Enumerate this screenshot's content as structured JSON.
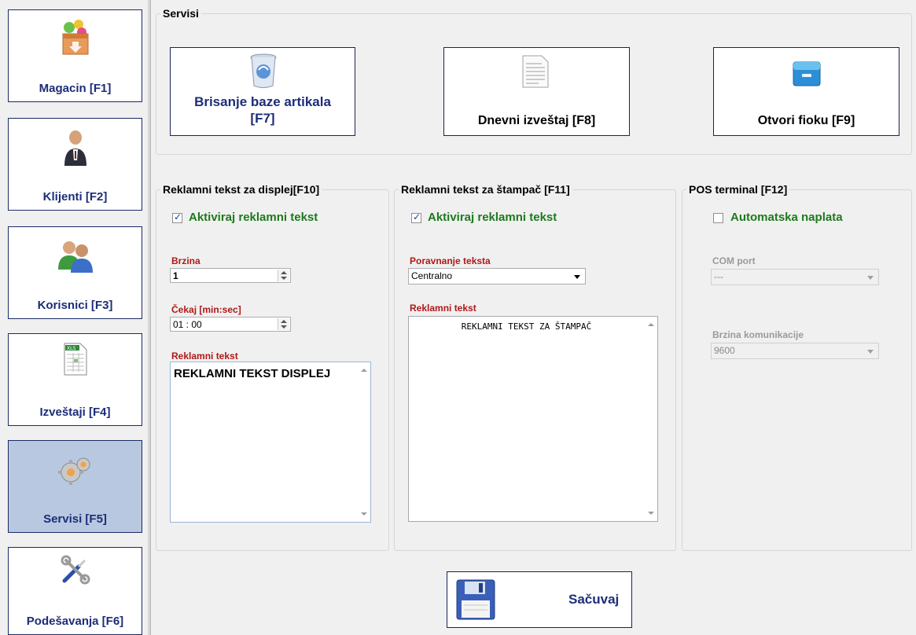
{
  "sidebar": {
    "items": [
      {
        "label": "Magacin [F1]",
        "icon": "warehouse-box-icon"
      },
      {
        "label": "Klijenti [F2]",
        "icon": "client-person-icon"
      },
      {
        "label": "Korisnici [F3]",
        "icon": "users-icon"
      },
      {
        "label": "Izveštaji [F4]",
        "icon": "xls-report-icon"
      },
      {
        "label": "Servisi [F5]",
        "icon": "gears-icon"
      },
      {
        "label": "Podešavanja [F6]",
        "icon": "tools-icon"
      }
    ],
    "active_index": 4
  },
  "servisi": {
    "title": "Servisi",
    "buttons": [
      {
        "label_line1": "Brisanje baze artikala",
        "label_line2": "[F7]",
        "icon": "recycle-bin-icon"
      },
      {
        "label": "Dnevni izveštaj [F8]",
        "icon": "document-icon"
      },
      {
        "label": "Otvori fioku [F9]",
        "icon": "drawer-icon"
      }
    ]
  },
  "display_panel": {
    "title": "Reklamni tekst za displej[F10]",
    "checkbox_label": "Aktiviraj reklamni tekst",
    "checked": true,
    "brzina_label": "Brzina",
    "brzina_value": "1",
    "cekaj_label": "Čekaj [min:sec]",
    "cekaj_value": "01 : 00",
    "text_label": "Reklamni tekst",
    "text_value": "REKLAMNI TEKST DISPLEJ"
  },
  "printer_panel": {
    "title": "Reklamni tekst za štampač [F11]",
    "checkbox_label": "Aktiviraj reklamni tekst",
    "checked": true,
    "align_label": "Poravnanje teksta",
    "align_value": "Centralno",
    "text_label": "Reklamni tekst",
    "text_value": "REKLAMNI TEKST ZA ŠTAMPAČ"
  },
  "pos_panel": {
    "title": "POS terminal [F12]",
    "checkbox_label": "Automatska naplata",
    "checked": false,
    "com_label": "COM port",
    "com_value": "---",
    "speed_label": "Brzina komunikacije",
    "speed_value": "9600"
  },
  "save_button": {
    "label": "Sačuvaj",
    "icon": "floppy-disk-icon"
  },
  "colors": {
    "accent_blue": "#1c2d78",
    "label_red": "#b01818",
    "label_green": "#1d7a1d",
    "active_bg": "#b8c8e0"
  }
}
